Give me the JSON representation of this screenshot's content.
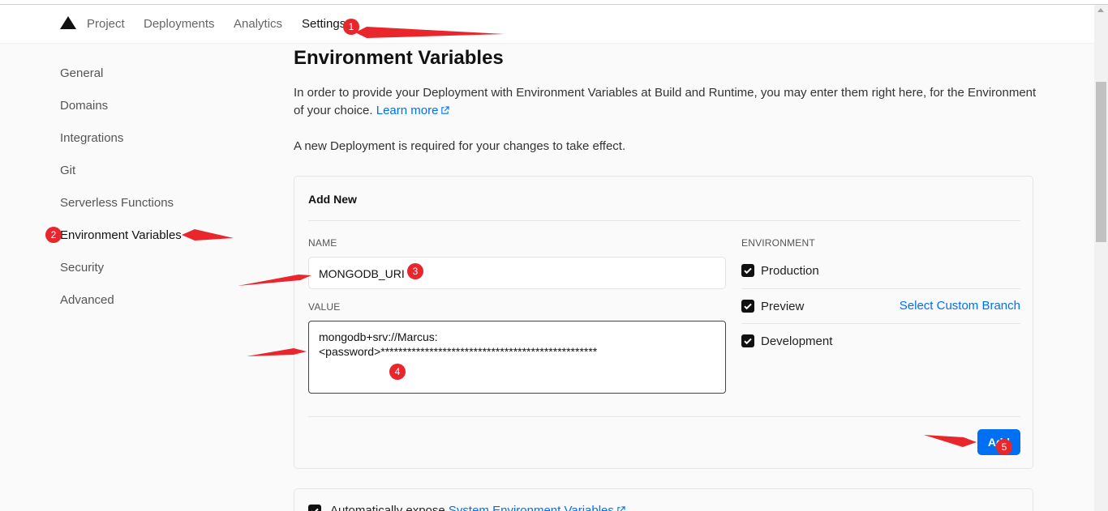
{
  "nav": {
    "items": [
      {
        "label": "Project"
      },
      {
        "label": "Deployments"
      },
      {
        "label": "Analytics"
      },
      {
        "label": "Settings"
      }
    ]
  },
  "sidebar": {
    "items": [
      {
        "label": "General"
      },
      {
        "label": "Domains"
      },
      {
        "label": "Integrations"
      },
      {
        "label": "Git"
      },
      {
        "label": "Serverless Functions"
      },
      {
        "label": "Environment Variables"
      },
      {
        "label": "Security"
      },
      {
        "label": "Advanced"
      }
    ]
  },
  "main": {
    "title": "Environment Variables",
    "description": "In order to provide your Deployment with Environment Variables at Build and Runtime, you may enter them right here, for the Environment of your choice.",
    "learn_more": "Learn more",
    "notice": "A new Deployment is required for your changes to take effect."
  },
  "add_new": {
    "title": "Add New",
    "name_label": "NAME",
    "name_value": "MONGODB_URI",
    "value_label": "VALUE",
    "value_line1": "mongodb+srv://Marcus:",
    "value_line2": "<password>*************************************************",
    "environment_label": "ENVIRONMENT",
    "environments": [
      {
        "label": "Production",
        "checked": true
      },
      {
        "label": "Preview",
        "checked": true
      },
      {
        "label": "Development",
        "checked": true
      }
    ],
    "select_custom_branch": "Select Custom Branch",
    "add_button": "Add"
  },
  "system_env": {
    "checked": true,
    "text": "Automatically expose",
    "link": "System Environment Variables"
  },
  "annotations": [
    "1",
    "2",
    "3",
    "4",
    "5"
  ],
  "colors": {
    "accent": "#0070f3",
    "annotation": "#e8262b",
    "checkbox": "#111111"
  }
}
